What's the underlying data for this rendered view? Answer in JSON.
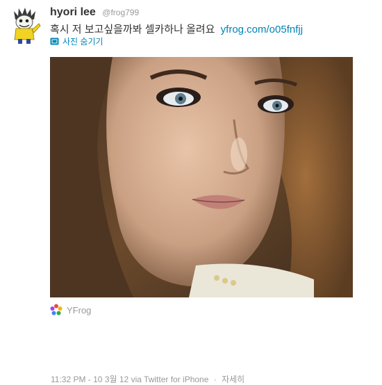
{
  "user": {
    "name": "hyori lee",
    "handle": "@frog799",
    "avatar_icon": "frog-cartoon-avatar"
  },
  "tweet": {
    "text": "혹시 저 보고싶을까봐 셀카하나 올려요",
    "link": "yfrog.com/o05fnfjj"
  },
  "media": {
    "hide_label": "사진 숨기기",
    "hide_icon": "photo-icon",
    "source_label": "YFrog",
    "source_icon": "yfrog-logo-icon"
  },
  "meta": {
    "timestamp": "11:32 PM - 10 3월 12",
    "via": "via Twitter for iPhone",
    "separator": "·",
    "details_label": "자세히"
  },
  "colors": {
    "link": "#0084b4",
    "text": "#333333",
    "muted": "#999999"
  }
}
